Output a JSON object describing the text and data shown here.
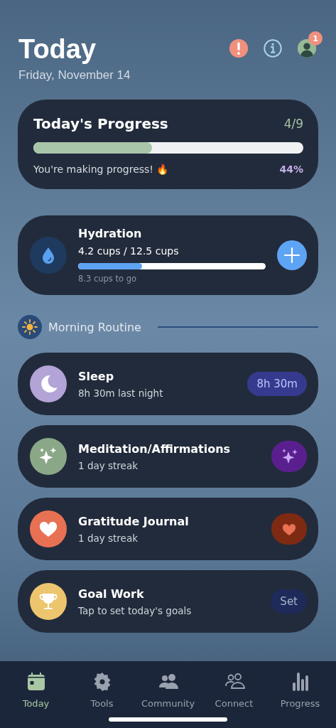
{
  "header": {
    "title": "Today",
    "date": "Friday, November 14",
    "notification_count": "1"
  },
  "progress": {
    "title": "Today's Progress",
    "count": "4/9",
    "level": 0.44,
    "message": "You're making progress! 🔥",
    "percent": "44%"
  },
  "hydration": {
    "title": "Hydration",
    "amount": "4.2 cups / 12.5 cups",
    "level": 0.34,
    "remaining": "8.3 cups to go"
  },
  "section": {
    "title": "Morning Routine"
  },
  "routines": [
    {
      "kind": "sleep",
      "title": "Sleep",
      "subtitle": "8h 30m last night",
      "badge": "8h 30m"
    },
    {
      "kind": "meditation",
      "title": "Meditation/Affirmations",
      "subtitle": "1 day streak"
    },
    {
      "kind": "gratitude",
      "title": "Gratitude Journal",
      "subtitle": "1 day streak"
    },
    {
      "kind": "goal",
      "title": "Goal Work",
      "subtitle": "Tap to set today's goals",
      "badge": "Set"
    }
  ],
  "tabs": [
    {
      "kind": "calendar",
      "label": "Today",
      "selected": true
    },
    {
      "kind": "gear",
      "label": "Tools",
      "selected": false
    },
    {
      "kind": "people",
      "label": "Community",
      "selected": false
    },
    {
      "kind": "people-outline",
      "label": "Connect",
      "selected": false
    },
    {
      "kind": "bars",
      "label": "Progress",
      "selected": false
    }
  ]
}
